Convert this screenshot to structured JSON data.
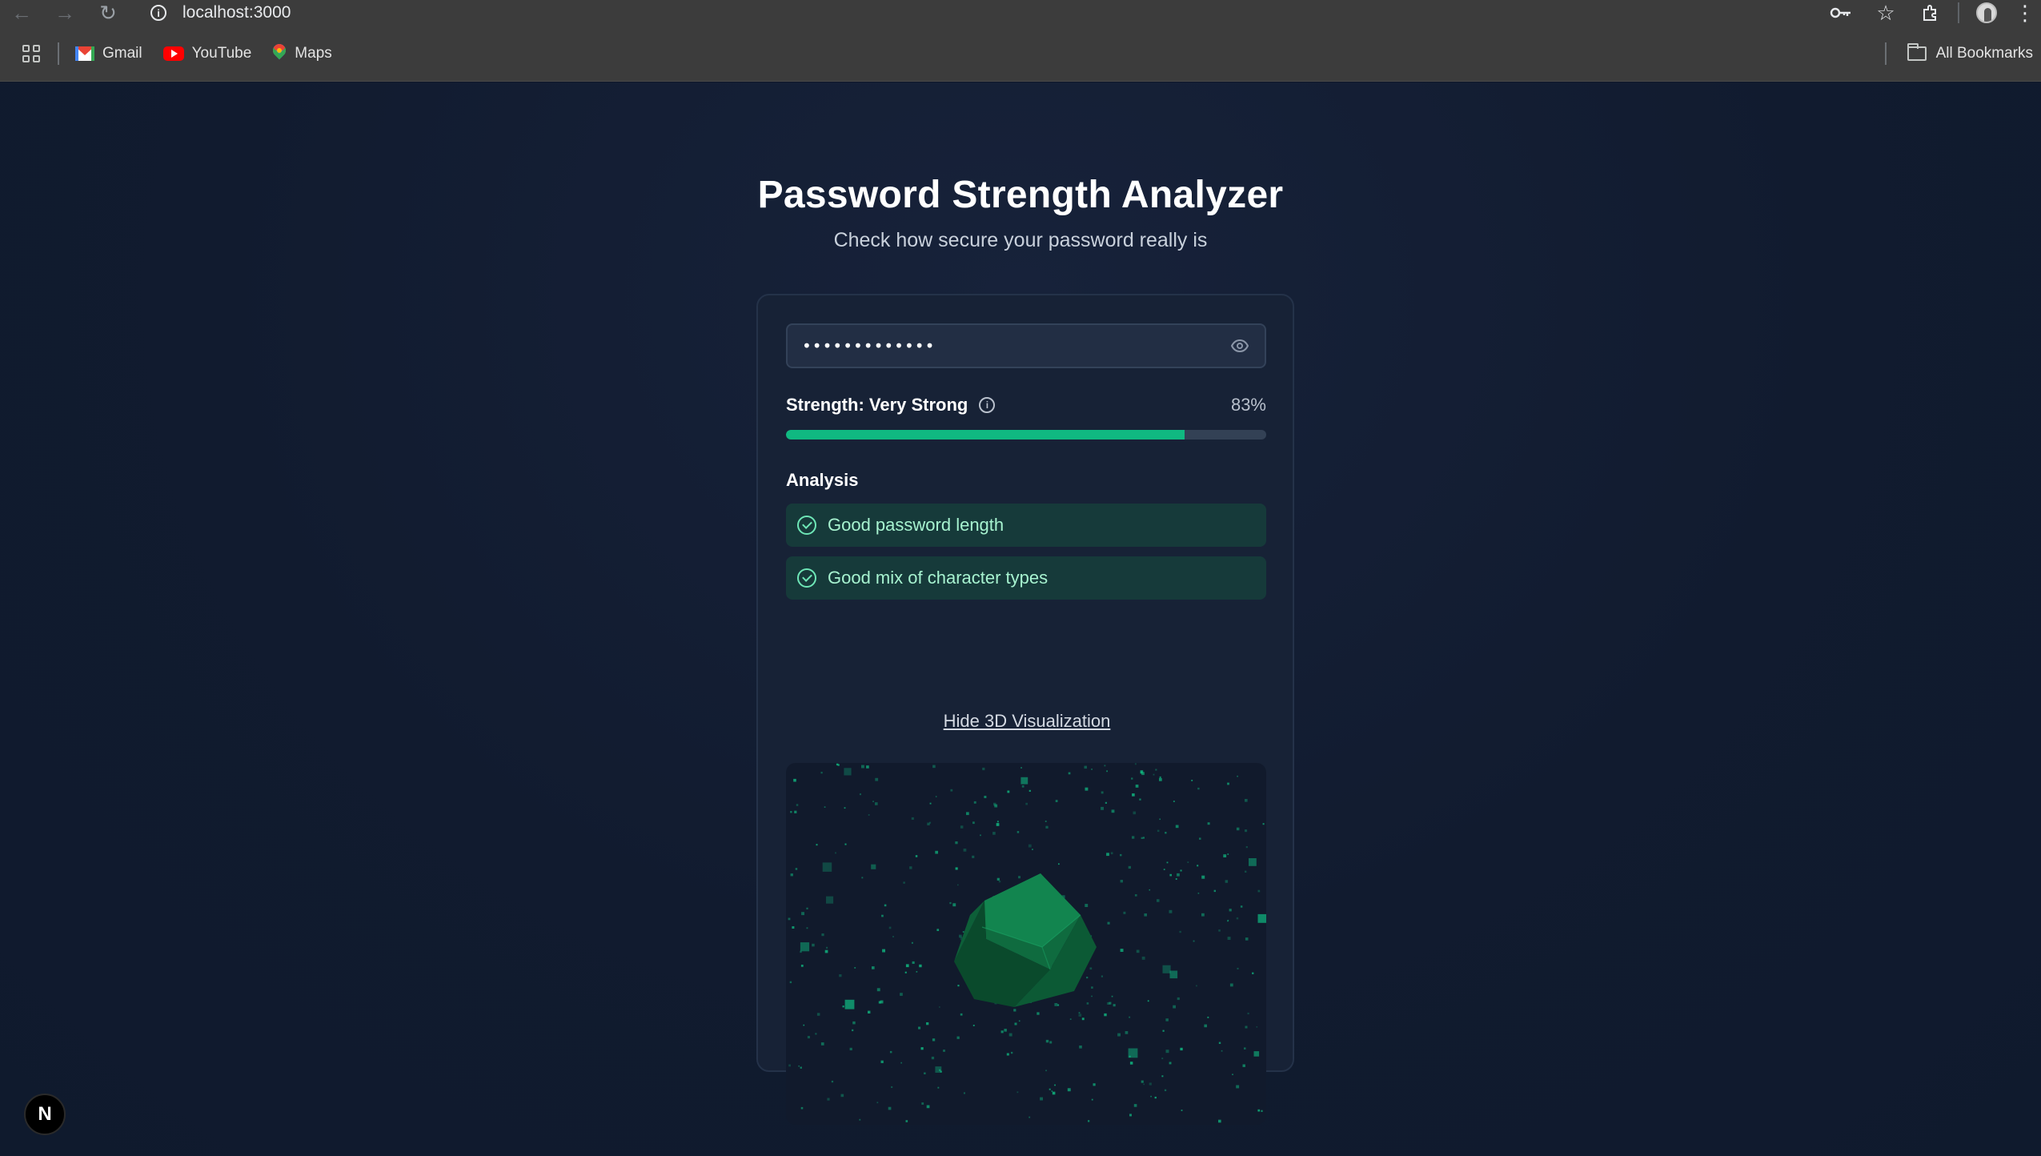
{
  "browser": {
    "url": "localhost:3000",
    "bookmarks": [
      {
        "label": "Gmail",
        "icon": "gmail-icon"
      },
      {
        "label": "YouTube",
        "icon": "youtube-icon"
      },
      {
        "label": "Maps",
        "icon": "maps-icon"
      }
    ],
    "all_bookmarks_label": "All Bookmarks"
  },
  "header": {
    "title": "Password Strength Analyzer",
    "subtitle": "Check how secure your password really is"
  },
  "password": {
    "masked_value": "•••••••••••••"
  },
  "strength": {
    "label": "Strength: Very Strong",
    "percent_text": "83%",
    "percent": 83,
    "bar_color": "#10b981"
  },
  "analysis": {
    "title": "Analysis",
    "items": [
      {
        "text": "Good password length"
      },
      {
        "text": "Good mix of character types"
      }
    ]
  },
  "visualization": {
    "toggle_label": "Hide 3D Visualization",
    "accent_color": "#10b981"
  },
  "framework_badge": {
    "letter": "N"
  }
}
